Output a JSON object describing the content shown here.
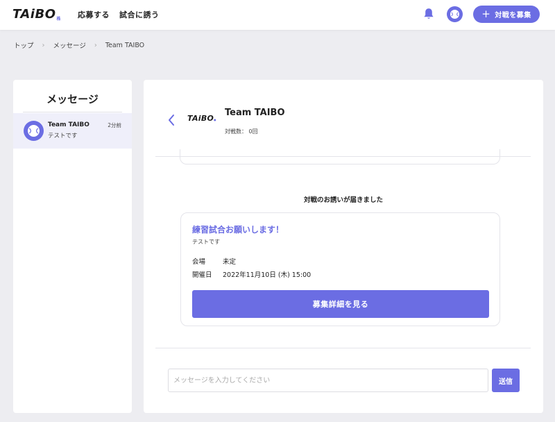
{
  "header": {
    "logo": "TAiBO",
    "logo_sub": "株",
    "nav": [
      {
        "label": "応募する"
      },
      {
        "label": "試合に誘う"
      }
    ],
    "recruit_button": "対戦を募集",
    "recruit_icon": "plus-icon",
    "notification_icon": "bell-icon",
    "avatar_icon": "baseball-icon"
  },
  "breadcrumb": [
    "トップ",
    "メッセージ",
    "Team TAIBO"
  ],
  "sidebar": {
    "title": "メッセージ",
    "conversations": [
      {
        "name": "Team TAIBO",
        "time": "2分前",
        "preview": "テストです",
        "icon": "baseball-icon"
      }
    ]
  },
  "chat": {
    "team_logo": "TAiBO",
    "team_name": "Team TAIBO",
    "stats": "対戦数： 0回",
    "invite_notice": "対戦のお誘いが届きました",
    "invite": {
      "title": "練習試合お願いします！",
      "message": "テストです",
      "venue_label": "会場",
      "venue_value": "未定",
      "date_label": "開催日",
      "date_value": "2022年11月10日 (木) 15:00",
      "button": "募集詳細を見る"
    },
    "input_placeholder": "メッセージを入力してください",
    "send_button": "送信"
  },
  "colors": {
    "accent": "#6b6de3",
    "background": "#ededf1",
    "selected_item": "#efeffa"
  }
}
